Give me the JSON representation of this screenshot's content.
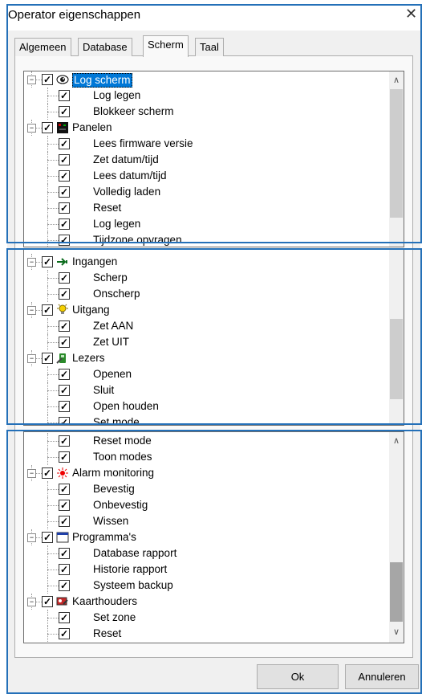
{
  "window": {
    "title": "Operator eigenschappen",
    "close_label": "✕"
  },
  "tabs": [
    {
      "label": "Algemeen"
    },
    {
      "label": "Database"
    },
    {
      "label": "Scherm"
    },
    {
      "label": "Taal"
    }
  ],
  "tree": {
    "panel1": [
      {
        "type": "group",
        "label": "Log scherm",
        "icon": "eye-icon",
        "selected": true
      },
      {
        "type": "leaf",
        "label": "Log legen"
      },
      {
        "type": "leaf",
        "label": "Blokkeer scherm"
      },
      {
        "type": "group",
        "label": "Panelen",
        "icon": "panel-icon"
      },
      {
        "type": "leaf",
        "label": "Lees firmware versie"
      },
      {
        "type": "leaf",
        "label": "Zet datum/tijd"
      },
      {
        "type": "leaf",
        "label": "Lees datum/tijd"
      },
      {
        "type": "leaf",
        "label": "Volledig laden"
      },
      {
        "type": "leaf",
        "label": "Reset"
      },
      {
        "type": "leaf",
        "label": "Log legen"
      },
      {
        "type": "leaf",
        "label": "Tijdzone opvragen"
      }
    ],
    "panel2": [
      {
        "type": "group",
        "label": "Ingangen",
        "icon": "input-arrow-icon"
      },
      {
        "type": "leaf",
        "label": "Scherp"
      },
      {
        "type": "leaf",
        "label": "Onscherp"
      },
      {
        "type": "group",
        "label": "Uitgang",
        "icon": "lightbulb-icon"
      },
      {
        "type": "leaf",
        "label": "Zet AAN"
      },
      {
        "type": "leaf",
        "label": "Zet UIT"
      },
      {
        "type": "group",
        "label": "Lezers",
        "icon": "reader-icon"
      },
      {
        "type": "leaf",
        "label": "Openen"
      },
      {
        "type": "leaf",
        "label": "Sluit"
      },
      {
        "type": "leaf",
        "label": "Open houden"
      },
      {
        "type": "leaf",
        "label": "Set mode"
      }
    ],
    "panel3": [
      {
        "type": "leaf",
        "label": "Reset mode"
      },
      {
        "type": "leaf",
        "label": "Toon modes"
      },
      {
        "type": "group",
        "label": "Alarm monitoring",
        "icon": "alarm-icon"
      },
      {
        "type": "leaf",
        "label": "Bevestig"
      },
      {
        "type": "leaf",
        "label": "Onbevestig"
      },
      {
        "type": "leaf",
        "label": "Wissen"
      },
      {
        "type": "group",
        "label": "Programma's",
        "icon": "program-window-icon"
      },
      {
        "type": "leaf",
        "label": "Database rapport"
      },
      {
        "type": "leaf",
        "label": "Historie rapport"
      },
      {
        "type": "leaf",
        "label": "Systeem backup"
      },
      {
        "type": "group",
        "label": "Kaarthouders",
        "icon": "cardholder-icon"
      },
      {
        "type": "leaf",
        "label": "Set zone"
      },
      {
        "type": "leaf",
        "label": "Reset"
      }
    ]
  },
  "buttons": {
    "ok": "Ok",
    "cancel": "Annuleren"
  },
  "colors": {
    "selection": "#0078d7",
    "frame": "#2470b8",
    "thumb": "#cdcdcd"
  }
}
